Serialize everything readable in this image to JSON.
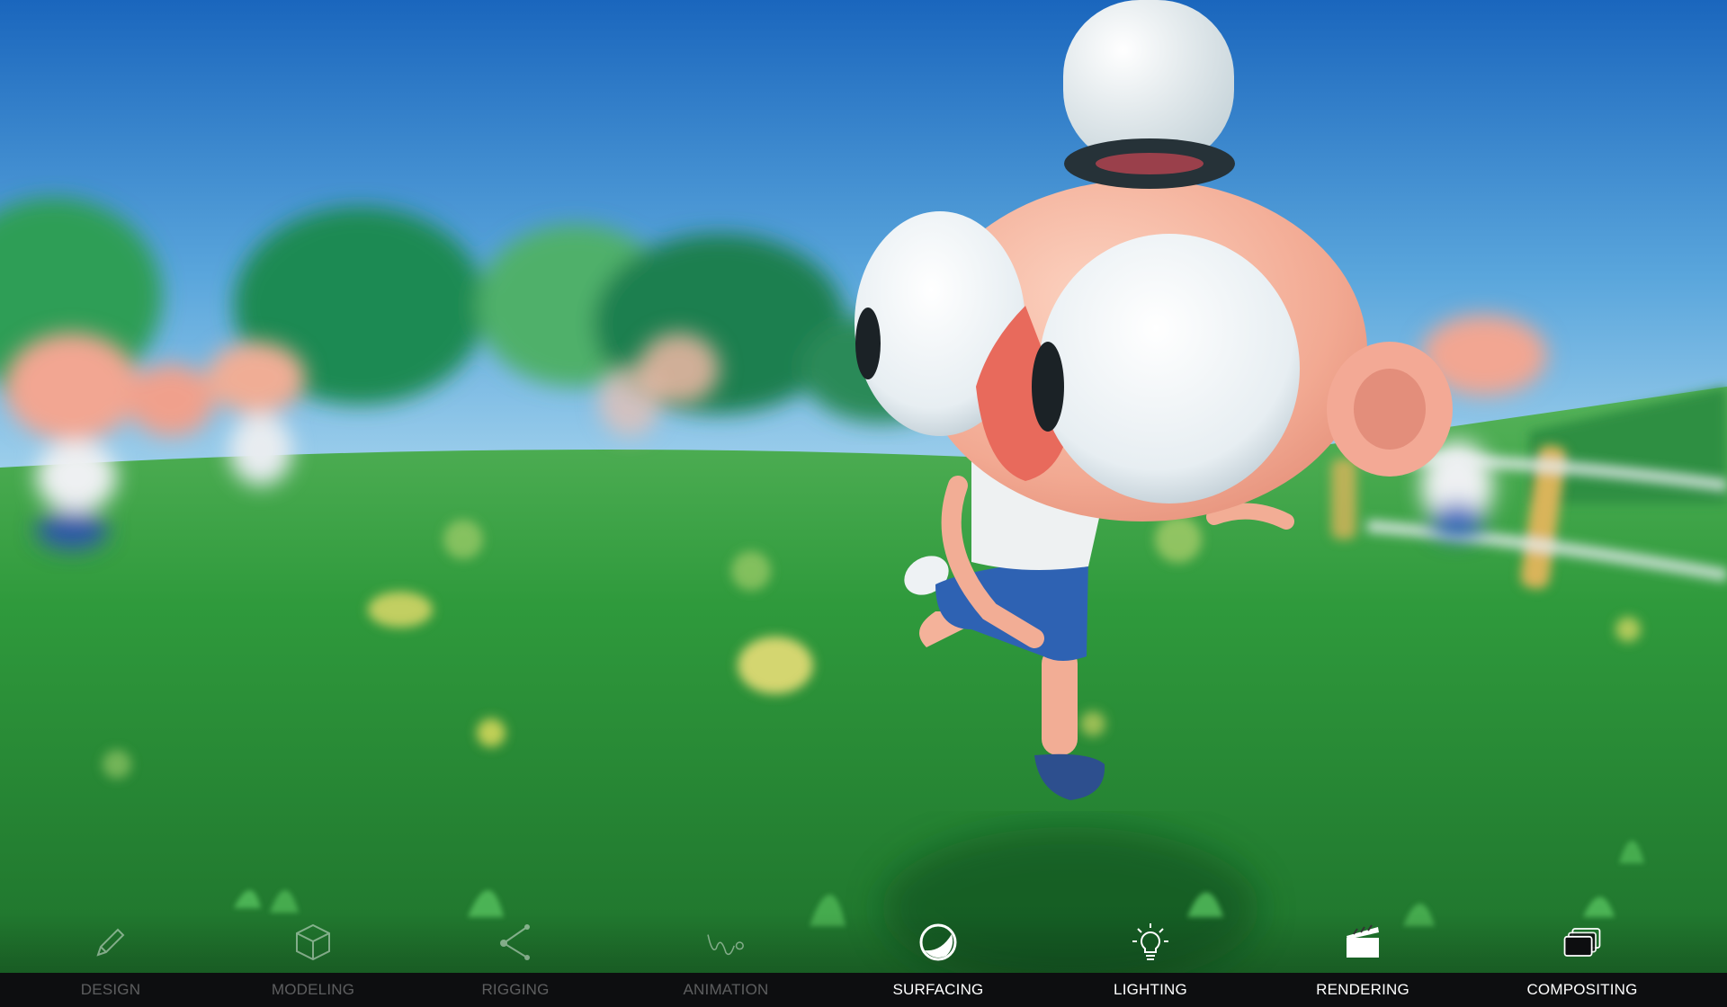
{
  "toolbar": {
    "stages": [
      {
        "id": "design",
        "label": "DESIGN",
        "icon": "pencil-icon",
        "active": false
      },
      {
        "id": "modeling",
        "label": "MODELING",
        "icon": "cube-icon",
        "active": false
      },
      {
        "id": "rigging",
        "label": "RIGGING",
        "icon": "joint-chain-icon",
        "active": false
      },
      {
        "id": "animation",
        "label": "ANIMATION",
        "icon": "motion-path-icon",
        "active": false
      },
      {
        "id": "surfacing",
        "label": "SURFACING",
        "icon": "shaded-sphere-icon",
        "active": true
      },
      {
        "id": "lighting",
        "label": "LIGHTING",
        "icon": "lightbulb-icon",
        "active": true
      },
      {
        "id": "rendering",
        "label": "RENDERING",
        "icon": "clapperboard-icon",
        "active": true
      },
      {
        "id": "compositing",
        "label": "COMPOSITING",
        "icon": "stacked-layers-icon",
        "active": true
      }
    ]
  },
  "colors": {
    "sky_top": "#1f6fc4",
    "sky_horizon": "#8fc6e8",
    "grass": "#2f9a3c",
    "skin": "#f4b29a",
    "nose": "#e86a5c",
    "shirt": "#eef1f2",
    "shorts": "#2e62b3",
    "hat": "#e9f0f2",
    "toolbar_bg": "#0d0e10"
  }
}
